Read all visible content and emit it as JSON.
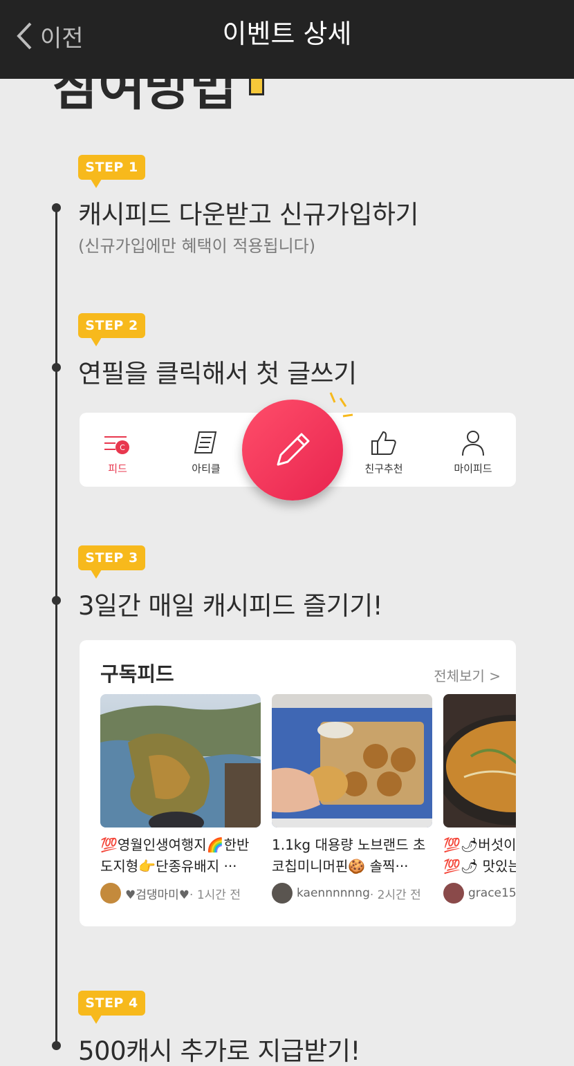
{
  "header": {
    "back_label": "이전",
    "title": "이벤트 상세"
  },
  "content": {
    "title": "참여방법"
  },
  "steps": [
    {
      "badge": "STEP 1",
      "text": "캐시피드 다운받고 신규가입하기",
      "sub": "(신규가입에만 혜택이 적용됩니다)"
    },
    {
      "badge": "STEP 2",
      "text": "연필을 클릭해서 첫 글쓰기"
    },
    {
      "badge": "STEP 3",
      "text": "3일간 매일 캐시피드 즐기기!"
    },
    {
      "badge": "STEP 4",
      "text": "500캐시 추가로 지급받기!"
    }
  ],
  "tabbar": {
    "tabs": [
      {
        "label": "피드",
        "icon": "feed-icon"
      },
      {
        "label": "아티클",
        "icon": "article-icon"
      },
      {
        "label": "친구추천",
        "icon": "thumbs-up-icon"
      },
      {
        "label": "마이피드",
        "icon": "person-icon"
      }
    ],
    "write_icon": "pencil-icon"
  },
  "feed": {
    "title": "구독피드",
    "more_label": "전체보기 >",
    "items": [
      {
        "title_line1": "💯영월인생여행지🌈한반",
        "title_line2": "도지형👉단종유배지 ···",
        "author": "♥검댕마미♥",
        "time": "· 1시간 전"
      },
      {
        "title_line1": "1.1kg 대용량 노브랜드 초",
        "title_line2": "코칩미니머핀🍪 솔찍···",
        "author": "kaennnnnng",
        "time": "· 2시간 전"
      },
      {
        "title_line1": "💯🌶버섯이",
        "title_line2": "💯🌶 맛있는",
        "author": "grace15",
        "time": ""
      }
    ]
  },
  "colors": {
    "accent": "#f7b91c",
    "brand_pink": "#e8374e",
    "header_bg": "#232323"
  }
}
